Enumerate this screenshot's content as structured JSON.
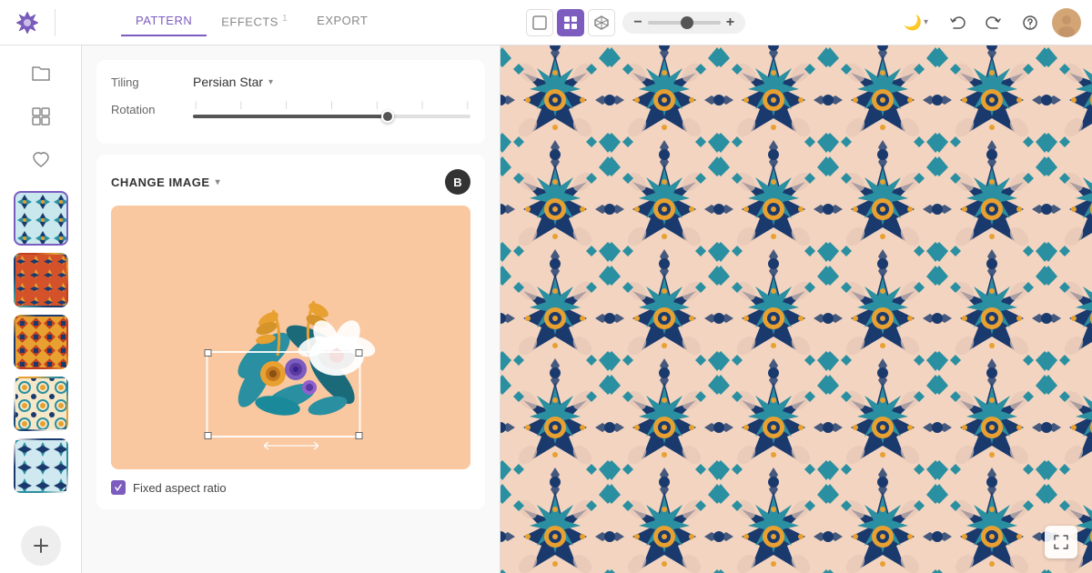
{
  "app": {
    "logo_alt": "Spoonflower logo"
  },
  "topbar": {
    "tabs": [
      {
        "id": "pattern",
        "label": "PATTERN",
        "active": true
      },
      {
        "id": "effects",
        "label": "EFFECTS",
        "active": false,
        "badge": "1"
      },
      {
        "id": "export",
        "label": "EXPORT",
        "active": false
      }
    ],
    "zoom": {
      "minus": "−",
      "plus": "+",
      "value": 50
    },
    "view_icons": [
      {
        "id": "square",
        "icon": "□",
        "active": false
      },
      {
        "id": "grid",
        "icon": "⊞",
        "active": true
      },
      {
        "id": "cube",
        "icon": "⬡",
        "active": false
      }
    ],
    "actions": {
      "moon": "🌙",
      "undo": "↩",
      "redo": "↪",
      "help": "?",
      "avatar_alt": "User avatar"
    }
  },
  "panel": {
    "tiling": {
      "label": "Tiling",
      "value": "Persian Star"
    },
    "rotation": {
      "label": "Rotation",
      "value": 70
    },
    "change_image": {
      "button_label": "CHANGE IMAGE",
      "badge": "B"
    },
    "checkbox": {
      "label": "Fixed aspect ratio",
      "checked": true
    }
  },
  "sidebar": {
    "icons": [
      {
        "id": "folder",
        "icon": "🗂",
        "label": "folder-icon"
      },
      {
        "id": "grid",
        "icon": "⊞",
        "label": "grid-icon"
      },
      {
        "id": "heart",
        "icon": "♡",
        "label": "heart-icon"
      }
    ],
    "patterns": [
      {
        "id": "1",
        "class": "thumb-1",
        "label": "Pattern 1",
        "active": true
      },
      {
        "id": "2",
        "class": "thumb-2",
        "label": "Pattern 2",
        "active": false
      },
      {
        "id": "3",
        "class": "thumb-3",
        "label": "Pattern 3",
        "active": false
      },
      {
        "id": "4",
        "class": "thumb-4",
        "label": "Pattern 4",
        "active": false
      },
      {
        "id": "5",
        "class": "thumb-5",
        "label": "Pattern 5",
        "active": false
      }
    ],
    "add_label": "+"
  },
  "canvas": {
    "pattern_name": "Persian Star",
    "expand_icon": "⛶"
  }
}
